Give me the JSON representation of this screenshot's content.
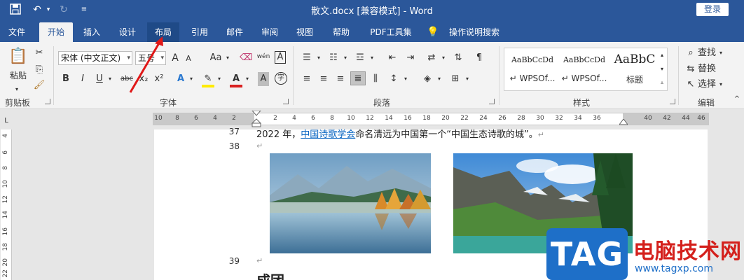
{
  "window": {
    "title": "散文.docx [兼容模式]  -  Word",
    "login_label": "登录",
    "save_icon": "save-icon",
    "undo_icon": "undo-icon",
    "redo_icon": "redo-icon",
    "customize_icon": "customize-quick-access-icon"
  },
  "tabs": [
    {
      "label": "文件"
    },
    {
      "label": "开始"
    },
    {
      "label": "插入"
    },
    {
      "label": "设计"
    },
    {
      "label": "布局"
    },
    {
      "label": "引用"
    },
    {
      "label": "邮件"
    },
    {
      "label": "审阅"
    },
    {
      "label": "视图"
    },
    {
      "label": "帮助"
    },
    {
      "label": "PDF工具集"
    },
    {
      "label": "操作说明搜索"
    }
  ],
  "ribbon": {
    "clipboard": {
      "group_label": "剪贴板",
      "paste_label": "粘贴"
    },
    "font": {
      "group_label": "字体",
      "font_name": "宋体 (中文正文)",
      "font_size": "五号",
      "bold": "B",
      "italic": "I",
      "underline": "U",
      "strike": "abc",
      "subscript": "x₂",
      "superscript": "x²",
      "grow": "A",
      "case": "Aa",
      "phonetic": "wén",
      "border_char": "A",
      "shade_char": "A",
      "enclose_char": "字"
    },
    "paragraph": {
      "group_label": "段落"
    },
    "styles": {
      "group_label": "样式",
      "items": [
        {
          "sample": "AaBbCcDd",
          "name": "↵ WPSOf..."
        },
        {
          "sample": "AaBbCcDd",
          "name": "↵ WPSOf..."
        },
        {
          "sample": "AaBbC",
          "name": "标题"
        }
      ]
    },
    "editing": {
      "group_label": "编辑",
      "find_label": "查找",
      "replace_label": "替换",
      "select_label": "选择"
    }
  },
  "ruler": {
    "h_ticks": [
      "10",
      "8",
      "6",
      "4",
      "2",
      "",
      "2",
      "4",
      "6",
      "8",
      "10",
      "12",
      "14",
      "16",
      "18",
      "20",
      "22",
      "24",
      "26",
      "28",
      "30",
      "32",
      "34",
      "36",
      "",
      "40",
      "42",
      "44",
      "46"
    ],
    "v_ticks": [
      "4",
      "6",
      "8",
      "10",
      "12",
      "14",
      "16",
      "18",
      "20",
      "22",
      "24"
    ]
  },
  "document": {
    "line37_num": "37",
    "line37_text_pre": "2022 年，",
    "line37_link": "中国诗歌学会",
    "line37_text_post": "命名清远为中国第一个“中国生态诗歌的城”。",
    "line38_num": "38",
    "line39_num": "39",
    "heading_partial": "成团"
  },
  "watermark": {
    "logo_text": "TAG",
    "cn_text": "电脑技术网",
    "url": "www.tagxp.com"
  }
}
